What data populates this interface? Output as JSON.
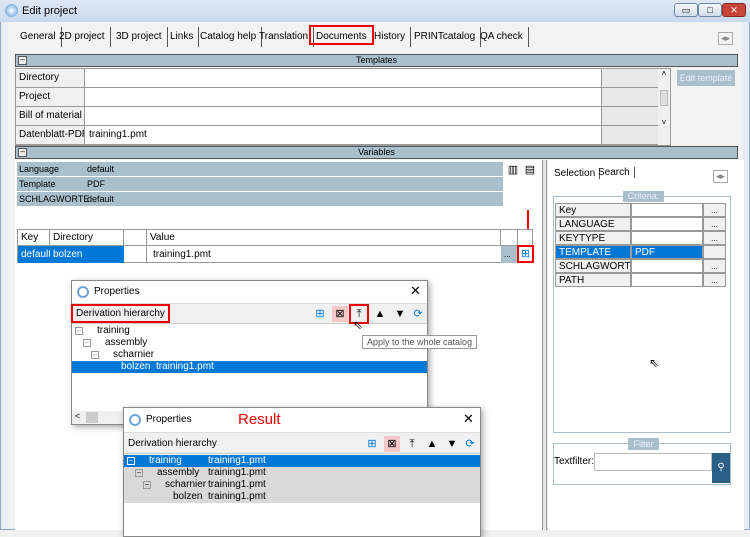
{
  "window": {
    "title": "Edit project",
    "minimize": "▭",
    "maximize": "□",
    "close": "✕"
  },
  "tabs": [
    "General",
    "2D project",
    "3D project",
    "Links",
    "Catalog help",
    "Translation",
    "Documents",
    "History",
    "PRINTcatalog",
    "QA check"
  ],
  "active_tab": "Documents",
  "templates": {
    "header": "Templates",
    "edit_button": "Edit template",
    "rows": [
      {
        "label": "Directory",
        "value": ""
      },
      {
        "label": "Project",
        "value": ""
      },
      {
        "label": "Bill of material",
        "value": ""
      },
      {
        "label": "Datenblatt-PDF",
        "value": "training1.pmt"
      }
    ]
  },
  "variables": {
    "header": "Variables",
    "rows": [
      {
        "key": "Language",
        "value": "default"
      },
      {
        "key": "Template",
        "value": "PDF"
      },
      {
        "key": "SCHLAGWORTE",
        "value": "default"
      }
    ]
  },
  "doc_table": {
    "headers": [
      "Key",
      "Directory",
      "",
      "Value"
    ],
    "row": {
      "key": "default",
      "directory": "bolzen",
      "value": "training1.pmt",
      "ellipsis": "..."
    }
  },
  "side": {
    "tabs": [
      "Selection",
      "Search"
    ],
    "criteria_label": "Criteria:",
    "criteria": [
      {
        "key": "Key",
        "value": ""
      },
      {
        "key": "LANGUAGE",
        "value": ""
      },
      {
        "key": "KEYTYPE",
        "value": ""
      },
      {
        "key": "TEMPLATE",
        "value": "PDF"
      },
      {
        "key": "SCHLAGWORTE",
        "value": ""
      },
      {
        "key": "PATH",
        "value": ""
      }
    ],
    "ellipsis": "...",
    "filter_label": "Filter",
    "textfilter_label": "Textfilter:",
    "textfilter_value": ""
  },
  "dialog1": {
    "title": "Properties",
    "section": "Derivation hierarchy",
    "tooltip": "Apply to the whole catalog",
    "tree": [
      {
        "name": "training",
        "file": ""
      },
      {
        "name": "assembly",
        "file": ""
      },
      {
        "name": "scharnier",
        "file": ""
      },
      {
        "name": "bolzen",
        "file": "training1.pmt"
      }
    ]
  },
  "dialog2": {
    "title": "Properties",
    "annotation": "Result",
    "section": "Derivation hierarchy",
    "tree": [
      {
        "name": "training",
        "file": "training1.pmt"
      },
      {
        "name": "assembly",
        "file": "training1.pmt"
      },
      {
        "name": "scharnier",
        "file": "training1.pmt"
      },
      {
        "name": "bolzen",
        "file": "training1.pmt"
      }
    ]
  },
  "colors": {
    "accent": "#0078d7",
    "section": "#a9bfcc",
    "highlight": "#e00000"
  }
}
